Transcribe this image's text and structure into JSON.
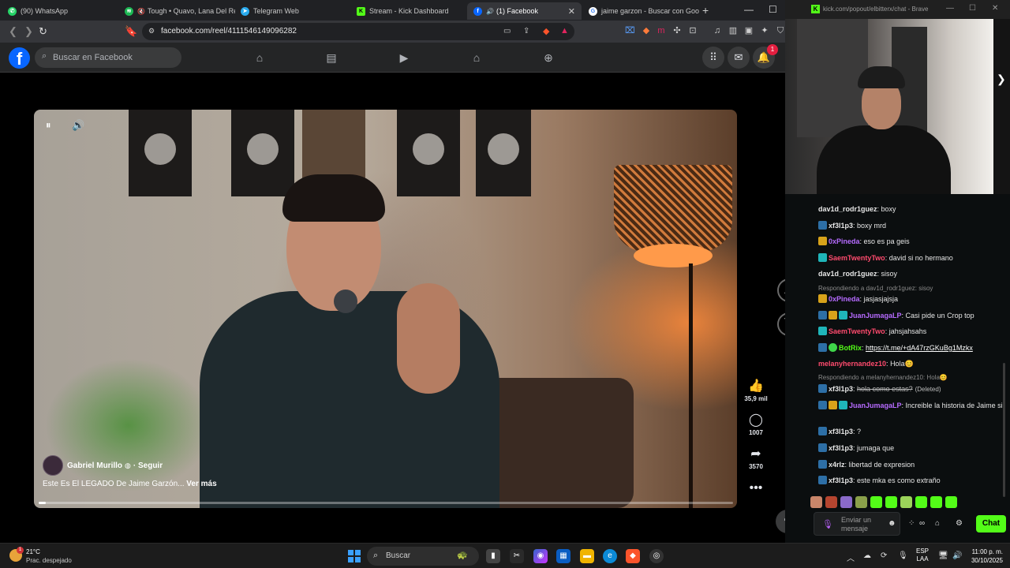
{
  "browser": {
    "tabs": [
      {
        "label": "(90) WhatsApp",
        "icon": "whatsapp-icon"
      },
      {
        "label": "Tough • Quavo, Lana Del Re",
        "icon": "spotify-icon"
      },
      {
        "label": "Telegram Web",
        "icon": "telegram-icon"
      },
      {
        "label": "Stream - Kick Dashboard",
        "icon": "kick-icon"
      },
      {
        "label": "(1) Facebook",
        "icon": "facebook-icon",
        "active": true
      },
      {
        "label": "jaime garzon - Buscar con Goog",
        "icon": "google-icon"
      }
    ],
    "url": "facebook.com/reel/4111546149096282"
  },
  "facebook": {
    "search_placeholder": "Buscar en Facebook",
    "notification_count": "1",
    "reel": {
      "author": "Gabriel Murillo",
      "follow": "· Seguir",
      "caption": "Este Es El LEGADO De Jaime Garzón...",
      "see_more": "Ver más",
      "progress": 0.01,
      "likes": "35,9 mil",
      "comments": "1007",
      "shares": "3570"
    }
  },
  "kick": {
    "window_title": "kick.com/popout/elbitterx/chat - Brave",
    "accent": "#53fc18",
    "chat_input_placeholder": "Enviar un mensaje",
    "chat_button": "Chat",
    "messages": [
      {
        "user": "dav1d_rodr1guez",
        "color": "#e6e6e6",
        "text": "boxy"
      },
      {
        "user": "xf3l1p3",
        "color": "#e6e6e6",
        "text": "boxy mrd"
      },
      {
        "user": "0xPineda",
        "color": "#b66bff",
        "text": "eso es pa geis"
      },
      {
        "user": "SaemTwentyTwo",
        "color": "#ff4b6e",
        "text": "david si no hermano"
      },
      {
        "user": "dav1d_rodr1guez",
        "color": "#e6e6e6",
        "text": "sisoy"
      },
      {
        "reply": "Respondiendo a dav1d_rodr1guez: sisoy"
      },
      {
        "user": "0xPineda",
        "color": "#b66bff",
        "text": "jasjasjajsja"
      },
      {
        "user": "JuanJumagaLP",
        "color": "#b66bff",
        "text": "Casi pide un Crop top"
      },
      {
        "user": "SaemTwentyTwo",
        "color": "#ff4b6e",
        "text": "jahsjahsahs"
      },
      {
        "user": "BotRix",
        "color": "#53fc18",
        "text": "https://t.me/+dA47rzGKuBg1Mzkx"
      },
      {
        "user": "melanyhernandez10",
        "color": "#ff4b6e",
        "text": "Hola😊"
      },
      {
        "reply": "Respondiendo a melanyhernandez10: Hola😊"
      },
      {
        "user": "xf3l1p3",
        "color": "#e6e6e6",
        "text": "hola como estas?",
        "deleted": "(Deleted)"
      },
      {
        "user": "JuanJumagaLP",
        "color": "#b66bff",
        "text": "Increible la historia de Jaime si"
      },
      {
        "user": "xf3l1p3",
        "color": "#e6e6e6",
        "text": "?"
      },
      {
        "user": "xf3l1p3",
        "color": "#e6e6e6",
        "text": "jumaga que"
      },
      {
        "user": "x4rlz",
        "color": "#e6e6e6",
        "text": "libertad de expresion"
      },
      {
        "user": "xf3l1p3",
        "color": "#e6e6e6",
        "text": "este mka es como extraño"
      }
    ]
  },
  "taskbar": {
    "temperature": "21°C",
    "weather": "Prac. despejado",
    "weather_badge": "1",
    "search_placeholder": "Buscar",
    "language_top": "ESP",
    "language_bottom": "LAA",
    "time": "11:00 p. m.",
    "date": "30/10/2025"
  }
}
